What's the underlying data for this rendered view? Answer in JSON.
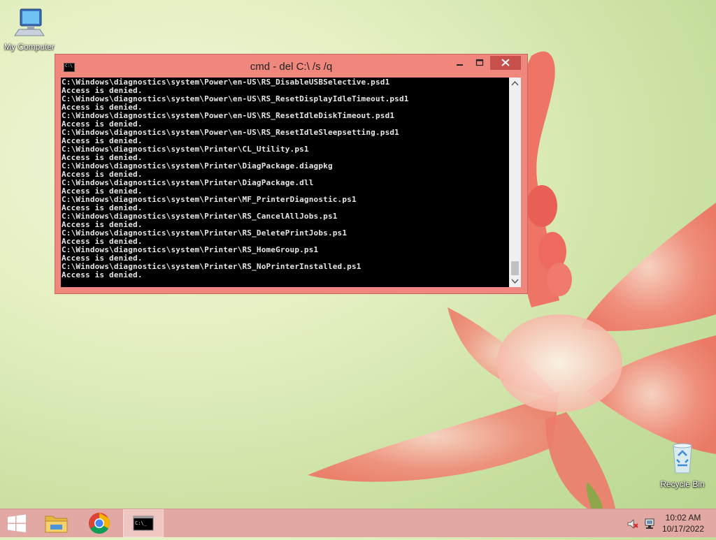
{
  "desktop": {
    "icons": [
      {
        "label": "My Computer"
      },
      {
        "label": "Recycle Bin"
      }
    ]
  },
  "window": {
    "title": "cmd - del  C:\\ /s /q",
    "console_lines": [
      "C:\\Windows\\diagnostics\\system\\Power\\en-US\\RS_DisableUSBSelective.psd1",
      "Access is denied.",
      "C:\\Windows\\diagnostics\\system\\Power\\en-US\\RS_ResetDisplayIdleTimeout.psd1",
      "Access is denied.",
      "C:\\Windows\\diagnostics\\system\\Power\\en-US\\RS_ResetIdleDiskTimeout.psd1",
      "Access is denied.",
      "C:\\Windows\\diagnostics\\system\\Power\\en-US\\RS_ResetIdleSleepsetting.psd1",
      "Access is denied.",
      "C:\\Windows\\diagnostics\\system\\Printer\\CL_Utility.ps1",
      "Access is denied.",
      "C:\\Windows\\diagnostics\\system\\Printer\\DiagPackage.diagpkg",
      "Access is denied.",
      "C:\\Windows\\diagnostics\\system\\Printer\\DiagPackage.dll",
      "Access is denied.",
      "C:\\Windows\\diagnostics\\system\\Printer\\MF_PrinterDiagnostic.ps1",
      "Access is denied.",
      "C:\\Windows\\diagnostics\\system\\Printer\\RS_CancelAllJobs.ps1",
      "Access is denied.",
      "C:\\Windows\\diagnostics\\system\\Printer\\RS_DeletePrintJobs.ps1",
      "Access is denied.",
      "C:\\Windows\\diagnostics\\system\\Printer\\RS_HomeGroup.ps1",
      "Access is denied.",
      "C:\\Windows\\diagnostics\\system\\Printer\\RS_NoPrinterInstalled.ps1",
      "Access is denied."
    ],
    "icon_text": "C:\\"
  },
  "taskbar": {
    "clock_time": "10:02 AM",
    "clock_date": "10/17/2022",
    "cmd_icon_text": "C:\\_"
  },
  "colors": {
    "window_frame": "#f0877c",
    "close_button": "#c7514a",
    "taskbar": "#e2a9a4"
  },
  "icons": [
    "computer-icon",
    "recycle-bin-icon",
    "cmd-icon",
    "minimize-icon",
    "maximize-icon",
    "close-icon",
    "windows-logo-icon",
    "file-explorer-icon",
    "chrome-icon",
    "speaker-muted-icon",
    "network-icon",
    "scroll-up-icon",
    "scroll-down-icon"
  ]
}
